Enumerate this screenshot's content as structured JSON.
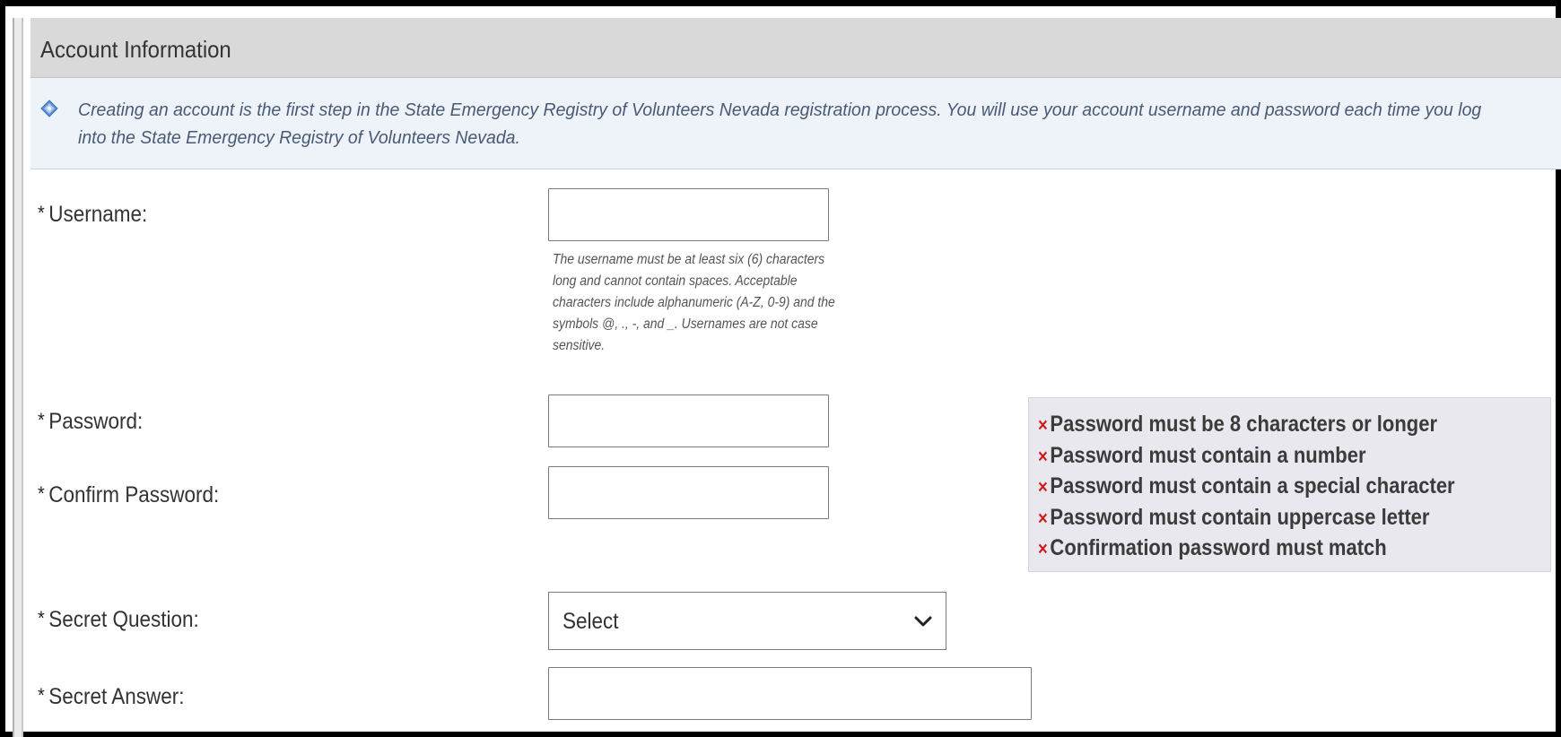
{
  "section": {
    "title": "Account Information",
    "info_text": "Creating an account is the first step in the State Emergency Registry of Volunteers Nevada registration process. You will use your account username and password each time you log into the State Emergency Registry of Volunteers Nevada."
  },
  "form": {
    "required_marker": "*",
    "username": {
      "label": "Username:",
      "value": "",
      "hint": "The username must be at least six (6) characters long and cannot contain spaces. Acceptable characters include alphanumeric (A-Z, 0-9) and the symbols @, ., -, and _. Usernames are not case sensitive."
    },
    "password": {
      "label": "Password:",
      "value": ""
    },
    "confirm_password": {
      "label": "Confirm Password:",
      "value": ""
    },
    "secret_question": {
      "label": "Secret Question:",
      "selected": "Select"
    },
    "secret_answer": {
      "label": "Secret Answer:",
      "value": ""
    }
  },
  "password_rules": {
    "status_icon": "x-mark",
    "status_color": "#d11a1a",
    "items": [
      "Password must be 8 characters or longer",
      "Password must contain a number",
      "Password must contain a special character",
      "Password must contain uppercase letter",
      "Confirmation password must match"
    ]
  },
  "colors": {
    "header_bg": "#d9d9d9",
    "info_bg": "#eef2f9",
    "info_icon": "#5b8fd6",
    "rules_bg": "#e8e8ee"
  },
  "icons": {
    "info": "info-diamond-icon",
    "select_arrow": "chevron-down-icon",
    "rule_status": "x-mark-icon"
  }
}
